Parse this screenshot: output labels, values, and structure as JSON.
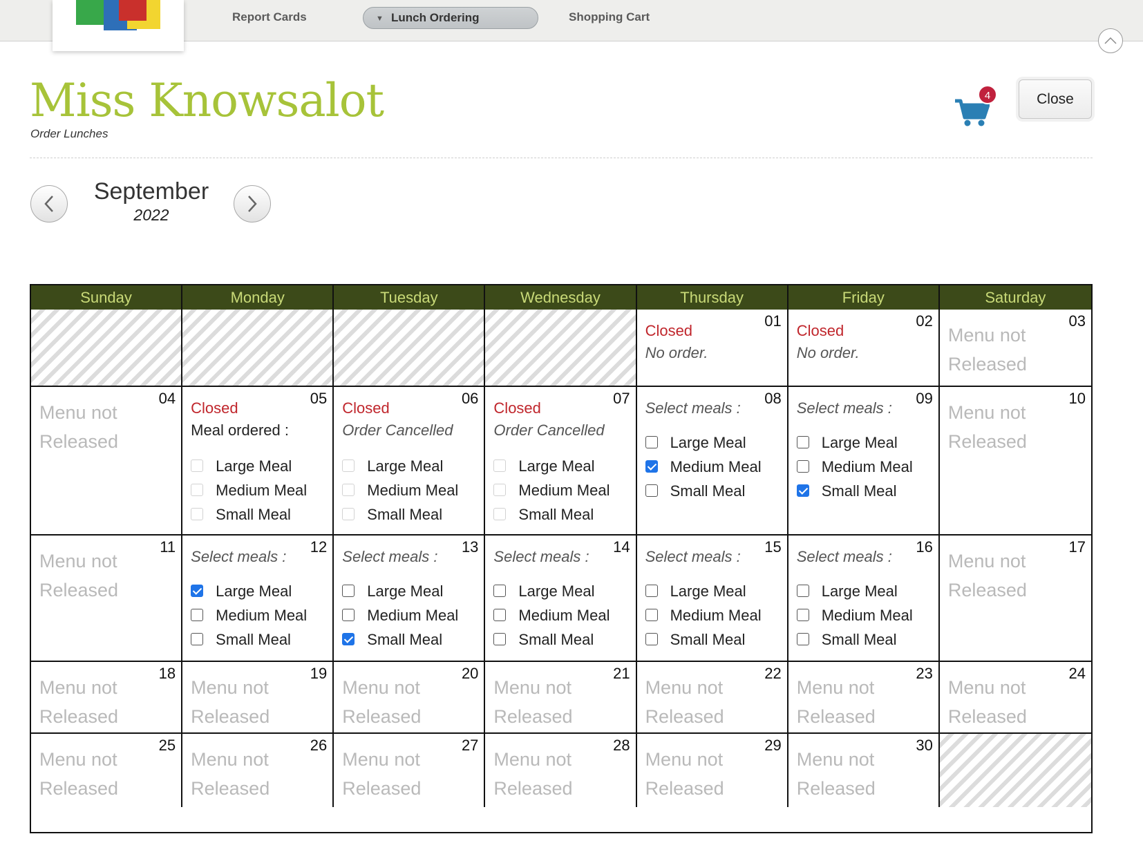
{
  "nav": {
    "items": [
      {
        "label": "Report Cards"
      },
      {
        "label": "Lunch Ordering"
      },
      {
        "label": "Shopping Cart"
      }
    ]
  },
  "header": {
    "student_name": "Miss Knowsalot",
    "subtitle": "Order Lunches",
    "cart_count": "4",
    "close_label": "Close"
  },
  "month_nav": {
    "month": "September",
    "year": "2022"
  },
  "colors": {
    "accent_green": "#a7c339",
    "header_bar": "#3c4a19",
    "closed_red": "#c0262c",
    "badge": "#c0213d",
    "cart_blue": "#2a7fb4"
  },
  "calendar": {
    "days_of_week": [
      "Sunday",
      "Monday",
      "Tuesday",
      "Wednesday",
      "Thursday",
      "Friday",
      "Saturday"
    ],
    "weeks": [
      [
        {
          "day": "",
          "kind": "blank"
        },
        {
          "day": "",
          "kind": "blank"
        },
        {
          "day": "",
          "kind": "blank"
        },
        {
          "day": "",
          "kind": "blank"
        },
        {
          "day": "01",
          "kind": "closed",
          "status": "Closed",
          "note": "No order."
        },
        {
          "day": "02",
          "kind": "closed",
          "status": "Closed",
          "note": "No order."
        },
        {
          "day": "03",
          "kind": "not_released",
          "text": "Menu not Released"
        }
      ],
      [
        {
          "day": "04",
          "kind": "not_released",
          "text": "Menu not Released"
        },
        {
          "day": "05",
          "kind": "closed_meals",
          "status": "Closed",
          "note": "Meal ordered :",
          "plain": true,
          "options": [
            {
              "label": "Large Meal",
              "checked": false
            },
            {
              "label": "Medium Meal",
              "checked": false
            },
            {
              "label": "Small Meal",
              "checked": false
            }
          ]
        },
        {
          "day": "06",
          "kind": "closed_meals",
          "status": "Closed",
          "note": "Order Cancelled",
          "options": [
            {
              "label": "Large Meal",
              "checked": false
            },
            {
              "label": "Medium Meal",
              "checked": false
            },
            {
              "label": "Small Meal",
              "checked": false
            }
          ]
        },
        {
          "day": "07",
          "kind": "closed_meals",
          "status": "Closed",
          "note": "Order Cancelled",
          "options": [
            {
              "label": "Large Meal",
              "checked": false
            },
            {
              "label": "Medium Meal",
              "checked": false
            },
            {
              "label": "Small Meal",
              "checked": false
            }
          ]
        },
        {
          "day": "08",
          "kind": "select",
          "label": "Select meals :",
          "options": [
            {
              "label": "Large Meal",
              "checked": false
            },
            {
              "label": "Medium Meal",
              "checked": true
            },
            {
              "label": "Small Meal",
              "checked": false
            }
          ]
        },
        {
          "day": "09",
          "kind": "select",
          "label": "Select meals :",
          "options": [
            {
              "label": "Large Meal",
              "checked": false
            },
            {
              "label": "Medium Meal",
              "checked": false
            },
            {
              "label": "Small Meal",
              "checked": true
            }
          ]
        },
        {
          "day": "10",
          "kind": "not_released",
          "text": "Menu not Released"
        }
      ],
      [
        {
          "day": "11",
          "kind": "not_released",
          "text": "Menu not Released"
        },
        {
          "day": "12",
          "kind": "select",
          "label": "Select meals :",
          "options": [
            {
              "label": "Large Meal",
              "checked": true
            },
            {
              "label": "Medium Meal",
              "checked": false
            },
            {
              "label": "Small Meal",
              "checked": false
            }
          ]
        },
        {
          "day": "13",
          "kind": "select",
          "label": "Select meals :",
          "options": [
            {
              "label": "Large Meal",
              "checked": false
            },
            {
              "label": "Medium Meal",
              "checked": false
            },
            {
              "label": "Small Meal",
              "checked": true
            }
          ]
        },
        {
          "day": "14",
          "kind": "select",
          "label": "Select meals :",
          "options": [
            {
              "label": "Large Meal",
              "checked": false
            },
            {
              "label": "Medium Meal",
              "checked": false
            },
            {
              "label": "Small Meal",
              "checked": false
            }
          ]
        },
        {
          "day": "15",
          "kind": "select",
          "label": "Select meals :",
          "options": [
            {
              "label": "Large Meal",
              "checked": false
            },
            {
              "label": "Medium Meal",
              "checked": false
            },
            {
              "label": "Small Meal",
              "checked": false
            }
          ]
        },
        {
          "day": "16",
          "kind": "select",
          "label": "Select meals :",
          "options": [
            {
              "label": "Large Meal",
              "checked": false
            },
            {
              "label": "Medium Meal",
              "checked": false
            },
            {
              "label": "Small Meal",
              "checked": false
            }
          ]
        },
        {
          "day": "17",
          "kind": "not_released",
          "text": "Menu not Released"
        }
      ],
      [
        {
          "day": "18",
          "kind": "not_released",
          "text": "Menu not Released"
        },
        {
          "day": "19",
          "kind": "not_released",
          "text": "Menu not Released"
        },
        {
          "day": "20",
          "kind": "not_released",
          "text": "Menu not Released"
        },
        {
          "day": "21",
          "kind": "not_released",
          "text": "Menu not Released"
        },
        {
          "day": "22",
          "kind": "not_released",
          "text": "Menu not Released"
        },
        {
          "day": "23",
          "kind": "not_released",
          "text": "Menu not Released"
        },
        {
          "day": "24",
          "kind": "not_released",
          "text": "Menu not Released"
        }
      ],
      [
        {
          "day": "25",
          "kind": "not_released",
          "text": "Menu not Released"
        },
        {
          "day": "26",
          "kind": "not_released",
          "text": "Menu not Released"
        },
        {
          "day": "27",
          "kind": "not_released",
          "text": "Menu not Released"
        },
        {
          "day": "28",
          "kind": "not_released",
          "text": "Menu not Released"
        },
        {
          "day": "29",
          "kind": "not_released",
          "text": "Menu not Released"
        },
        {
          "day": "30",
          "kind": "not_released",
          "text": "Menu not Released"
        },
        {
          "day": "",
          "kind": "blank"
        }
      ]
    ]
  }
}
